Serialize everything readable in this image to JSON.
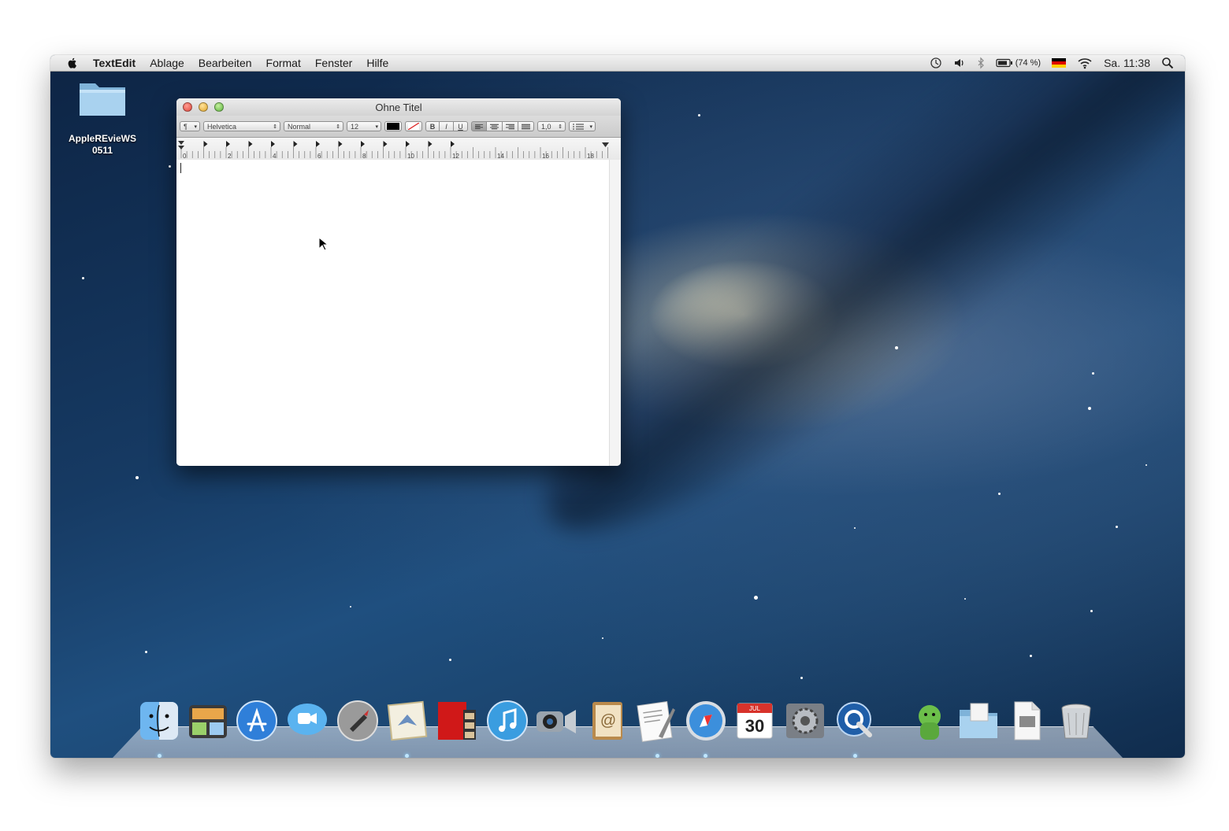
{
  "menubar": {
    "app_name": "TextEdit",
    "menus": [
      "Ablage",
      "Bearbeiten",
      "Format",
      "Fenster",
      "Hilfe"
    ],
    "battery": "(74 %)",
    "clock": "Sa. 11:38",
    "icons": [
      "apple-icon",
      "time-machine-icon",
      "volume-icon",
      "bluetooth-icon",
      "battery-icon",
      "flag-de-icon",
      "wifi-icon",
      "spotlight-icon"
    ]
  },
  "desktop": {
    "folder_label": "AppleREvieWS\n0511"
  },
  "window": {
    "title": "Ohne Titel",
    "toolbar": {
      "paragraph": "¶",
      "font": "Helvetica",
      "style": "Normal",
      "size": "12",
      "bold": "B",
      "italic": "I",
      "underline": "U",
      "spacing": "1,0"
    },
    "ruler_labels": [
      "0",
      "2",
      "4",
      "6",
      "8",
      "10",
      "12",
      "14",
      "16",
      "18"
    ]
  },
  "dock": {
    "items": [
      "Finder",
      "Dashboard",
      "App Store",
      "FaceTime",
      "Launchpad",
      "Mail",
      "Photo Booth",
      "iTunes",
      "FaceTime Video",
      "Adressbuch",
      "Vorschau",
      "Safari",
      "Kalender",
      "Systemeinstellungen",
      "QuickTime",
      "Jabber",
      "Downloads",
      "Dokumente",
      "Papierkorb"
    ],
    "calendar_day": "30",
    "calendar_month": "JUL"
  },
  "colors": {
    "menubar_bg": "#e4e4e4",
    "desktop_bg": "#163a63",
    "close": "#e0443a",
    "minimize": "#e1a52a",
    "zoom": "#5bb43c"
  }
}
